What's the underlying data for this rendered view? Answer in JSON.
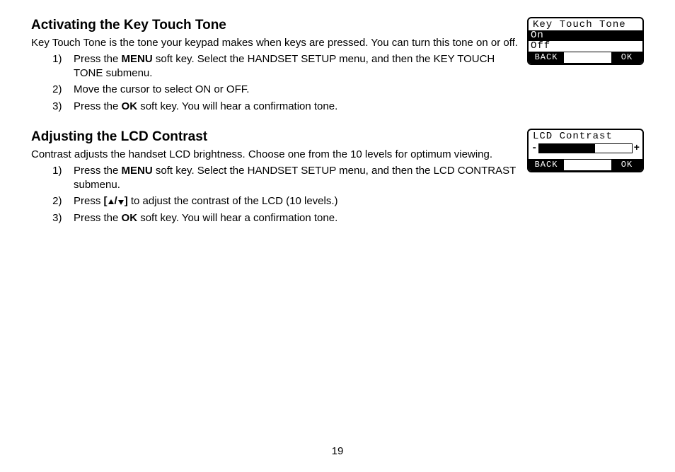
{
  "page_number": "19",
  "section1": {
    "title": "Activating the Key Touch Tone",
    "intro": "Key Touch Tone is the tone your keypad makes when keys are pressed. You can turn this tone on or off.",
    "step1_a": "Press the ",
    "step1_b": "MENU",
    "step1_c": " soft key. Select the HANDSET SETUP menu, and then the KEY TOUCH TONE submenu.",
    "step2": "Move the cursor to select ON or OFF.",
    "step3_a": "Press the ",
    "step3_b": "OK",
    "step3_c": " soft key. You will hear a confirmation tone.",
    "lcd": {
      "title": "Key Touch Tone",
      "opt1": "On",
      "opt2": "Off",
      "back": "BACK",
      "ok": "OK"
    }
  },
  "section2": {
    "title": "Adjusting the LCD Contrast",
    "intro": "Contrast adjusts the handset LCD brightness. Choose one from the 10 levels for opti­mum viewing.",
    "step1_a": "Press the ",
    "step1_b": "MENU",
    "step1_c": " soft key. Select the HANDSET SETUP menu, and then the LCD CONTRAST submenu.",
    "step2_a": "Press ",
    "step2_b": "[",
    "step2_c": "/",
    "step2_d": "]",
    "step2_e": " to adjust the contrast of the LCD (10 levels.)",
    "step3_a": "Press the ",
    "step3_b": "OK",
    "step3_c": " soft key. You will hear a confirmation tone.",
    "lcd": {
      "title": "LCD Contrast",
      "minus": "-",
      "plus": "+",
      "back": "BACK",
      "ok": "OK"
    }
  }
}
